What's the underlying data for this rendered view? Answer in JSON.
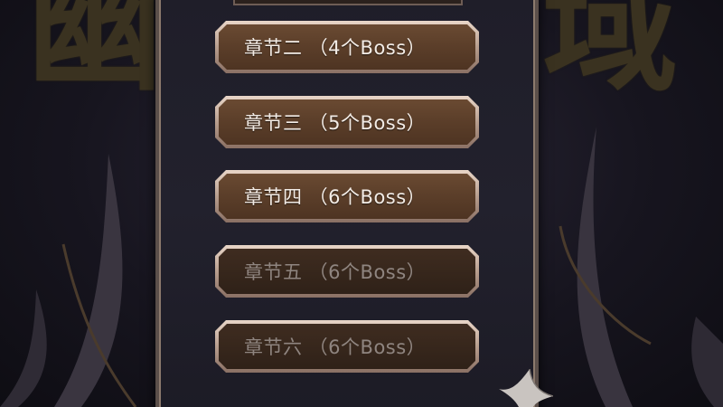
{
  "background": {
    "title_left": "幽",
    "title_right": "域"
  },
  "chapters": [
    {
      "label": "章节二 （4个Boss）",
      "locked": false
    },
    {
      "label": "章节三 （5个Boss）",
      "locked": false
    },
    {
      "label": "章节四 （6个Boss）",
      "locked": false
    },
    {
      "label": "章节五 （6个Boss）",
      "locked": true
    },
    {
      "label": "章节六 （6个Boss）",
      "locked": true
    }
  ],
  "colors": {
    "button_active": "#5c3f2a",
    "button_locked": "#37271c",
    "button_border": "#d9c3b3",
    "panel": "#1f1e29"
  }
}
